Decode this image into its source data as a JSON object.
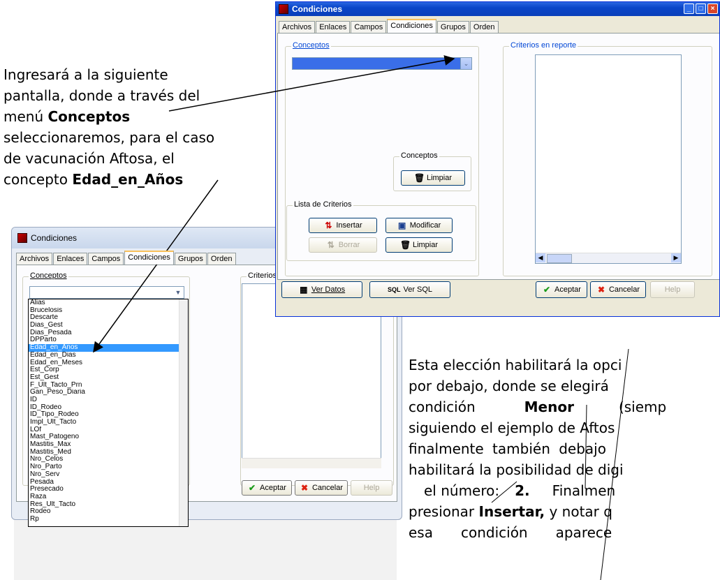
{
  "text_left": {
    "line1": "Ingresará a la siguiente",
    "line2": "pantalla, donde a través del",
    "line3_pre": "menú ",
    "line3_bold": "Conceptos",
    "line4": "seleccionaremos, para el caso",
    "line5": "de vacunación Aftosa, el",
    "line6_pre": "concepto ",
    "line6_bold": "Edad_en_Años"
  },
  "text_right": {
    "l1": "Esta elección habilitará la opci",
    "l2": "por debajo, donde se elegirá",
    "l3_pre": "condición",
    "l3_bold": "Menor",
    "l3_post": "(siemp",
    "l4": "siguiendo el ejemplo de Aftos",
    "l5": "finalmente también debajo",
    "l6": "habilitará la posibilidad de digi",
    "l7_pre": "el número:",
    "l7_bold": "2.",
    "l7_post": "Finalmen",
    "l8_pre": "presionar",
    "l8_bold": "Insertar,",
    "l8_post": "y notar q",
    "l9_pre": "esa",
    "l9_mid": "condición",
    "l9_post": "aparece"
  },
  "win1": {
    "title": "Condiciones",
    "tabs": [
      "Archivos",
      "Enlaces",
      "Campos",
      "Condiciones",
      "Grupos",
      "Orden"
    ],
    "conceptos_label": "Conceptos",
    "criterios_label": "Criterios en reporte",
    "conceptos_group": "Conceptos",
    "limpiar": "Limpiar",
    "lista_label": "Lista de Criterios",
    "insertar": "Insertar",
    "modificar": "Modificar",
    "borrar": "Borrar",
    "limpiar2": "Limpiar",
    "ver_datos": "Ver Datos",
    "ver_sql": "Ver SQL",
    "sql_tag": "SQL",
    "aceptar": "Aceptar",
    "cancelar": "Cancelar",
    "help": "Help"
  },
  "win2": {
    "title": "Condiciones",
    "tabs": [
      "Archivos",
      "Enlaces",
      "Campos",
      "Condiciones",
      "Grupos",
      "Orden"
    ],
    "conceptos_label": "Conceptos",
    "criterios_label": "Criterios",
    "aceptar": "Aceptar",
    "cancelar": "Cancelar",
    "help": "Help",
    "list_items": [
      "Alias",
      "Brucelosis",
      "Descarte",
      "Dias_Gest",
      "Dias_Pesada",
      "DPParto",
      "Edad_en_Anos",
      "Edad_en_Dias",
      "Edad_en_Meses",
      "Est_Corp",
      "Est_Gest",
      "F_Ult_Tacto_Prn",
      "Gan_Peso_Diaria",
      "ID",
      "ID_Rodeo",
      "ID_Tipo_Rodeo",
      "Impl_Ult_Tacto",
      "LOf",
      "Mast_Patogeno",
      "Mastitis_Max",
      "Mastitis_Med",
      "Nro_Celos",
      "Nro_Parto",
      "Nro_Serv",
      "Pesada",
      "Presecado",
      "Raza",
      "Res_Ult_Tacto",
      "Rodeo",
      "Rp"
    ],
    "selected_item": "Edad_en_Anos"
  }
}
